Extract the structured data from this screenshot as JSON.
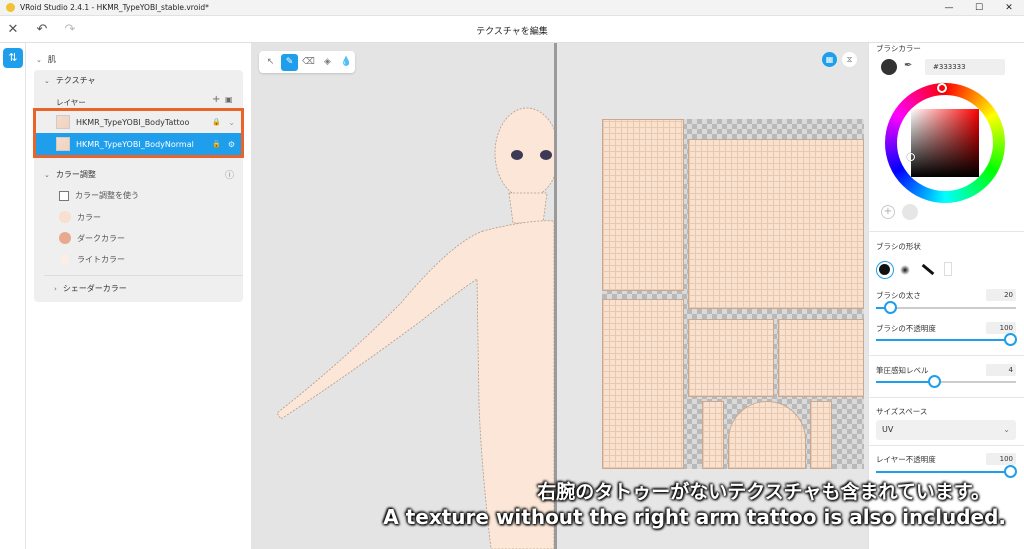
{
  "window": {
    "title": "VRoid Studio 2.4.1 - HKMR_TypeYOBI_stable.vroid*",
    "controls": [
      "—",
      "☐",
      "✕"
    ]
  },
  "toolbar": {
    "page_title": "テクスチャを編集",
    "close_glyph": "✕",
    "undo_glyph": "↶",
    "redo_glyph": "↷"
  },
  "rail": {
    "active_icon": "texture-edit-icon",
    "glyph": "⇅"
  },
  "left_panel": {
    "section_title": "肌",
    "texture": {
      "title": "テクスチャ",
      "layers_label": "レイヤー",
      "layers": [
        {
          "name": "HKMR_TypeYOBI_BodyTattoo",
          "selected": false
        },
        {
          "name": "HKMR_TypeYOBI_BodyNormal",
          "selected": true
        }
      ]
    },
    "color_adjust": {
      "title": "カラー調整",
      "use_label": "カラー調整を使う",
      "options": [
        {
          "label": "カラー",
          "color": "#f8dfcf"
        },
        {
          "label": "ダークカラー",
          "color": "#e7a98f"
        },
        {
          "label": "ライトカラー",
          "color": "#fbeee6"
        }
      ]
    },
    "shader_color": "シェーダーカラー"
  },
  "viewport": {
    "tools": [
      "select-tool-icon",
      "brush-tool-icon",
      "eraser-tool-icon",
      "fill-tool-icon",
      "eyedropper-tool-icon"
    ],
    "active_tool": "brush-tool-icon"
  },
  "right_panel": {
    "brush_color_label": "ブラシカラー",
    "hex_value": "#333333",
    "current_color": "#333333",
    "brush_shape_label": "ブラシの形状",
    "brush_size": {
      "label": "ブラシの太さ",
      "value": "20",
      "fraction": 0.1
    },
    "brush_opacity": {
      "label": "ブラシの不透明度",
      "value": "100",
      "fraction": 1.0
    },
    "pressure": {
      "label": "筆圧感知レベル",
      "value": "4",
      "fraction": 0.4
    },
    "size_space_label": "サイズスペース",
    "size_space_value": "UV",
    "layer_opacity": {
      "label": "レイヤー不透明度",
      "value": "100",
      "fraction": 1.0
    }
  },
  "subtitles": {
    "jp": "右腕のタトゥーがないテクスチャも含まれています。",
    "en": "A texture without the right arm tattoo is also included."
  }
}
